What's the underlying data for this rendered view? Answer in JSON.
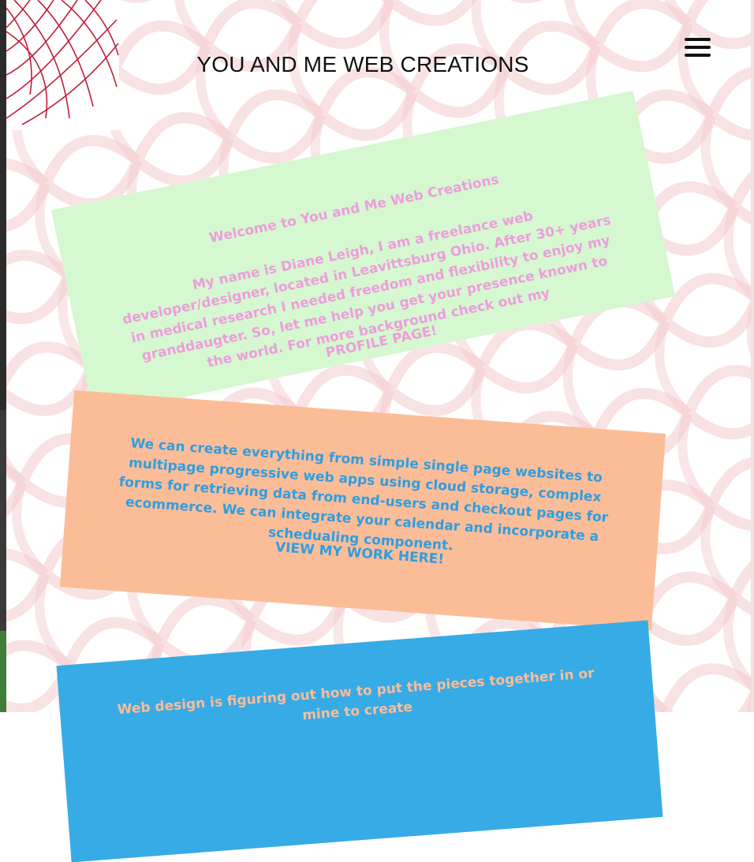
{
  "site": {
    "title": "YOU AND ME WEB CREATIONS"
  },
  "header": {
    "menu_icon": "hamburger-menu-icon",
    "logo_icon": "spider-web-logo-icon"
  },
  "panels": {
    "welcome": {
      "heading": "Welcome to You and Me Web Creations",
      "body": "My name is Diane Leigh, I am a freelance web developer/designer, located in Leavittsburg Ohio. After 30+ years in medical research I needed freedom and flexibility to enjoy my granddaugter. So, let me help you get your presence known to the world. For more background check out my",
      "link": "PROFILE PAGE!",
      "background": "#d6f8d0",
      "text_color": "#ee9ddd"
    },
    "services": {
      "body": "We can create everything from simple single page websites to multipage progressive web apps using cloud storage, complex forms for retrieving data from end-users and checkout pages for ecommerce. We can integrate your calendar and incorporate a schedualing component.",
      "link": "VIEW MY WORK HERE!",
      "background": "#fbbd98",
      "text_color": "#2f9ee0"
    },
    "design": {
      "body": "Web design is figuring out how to put the pieces together in",
      "body_line2": "or mine to create",
      "background": "#37abe6",
      "text_color": "#fbbd98"
    }
  },
  "colors": {
    "pattern": "#f3c9cc",
    "logo_stroke": "#c0203a"
  }
}
